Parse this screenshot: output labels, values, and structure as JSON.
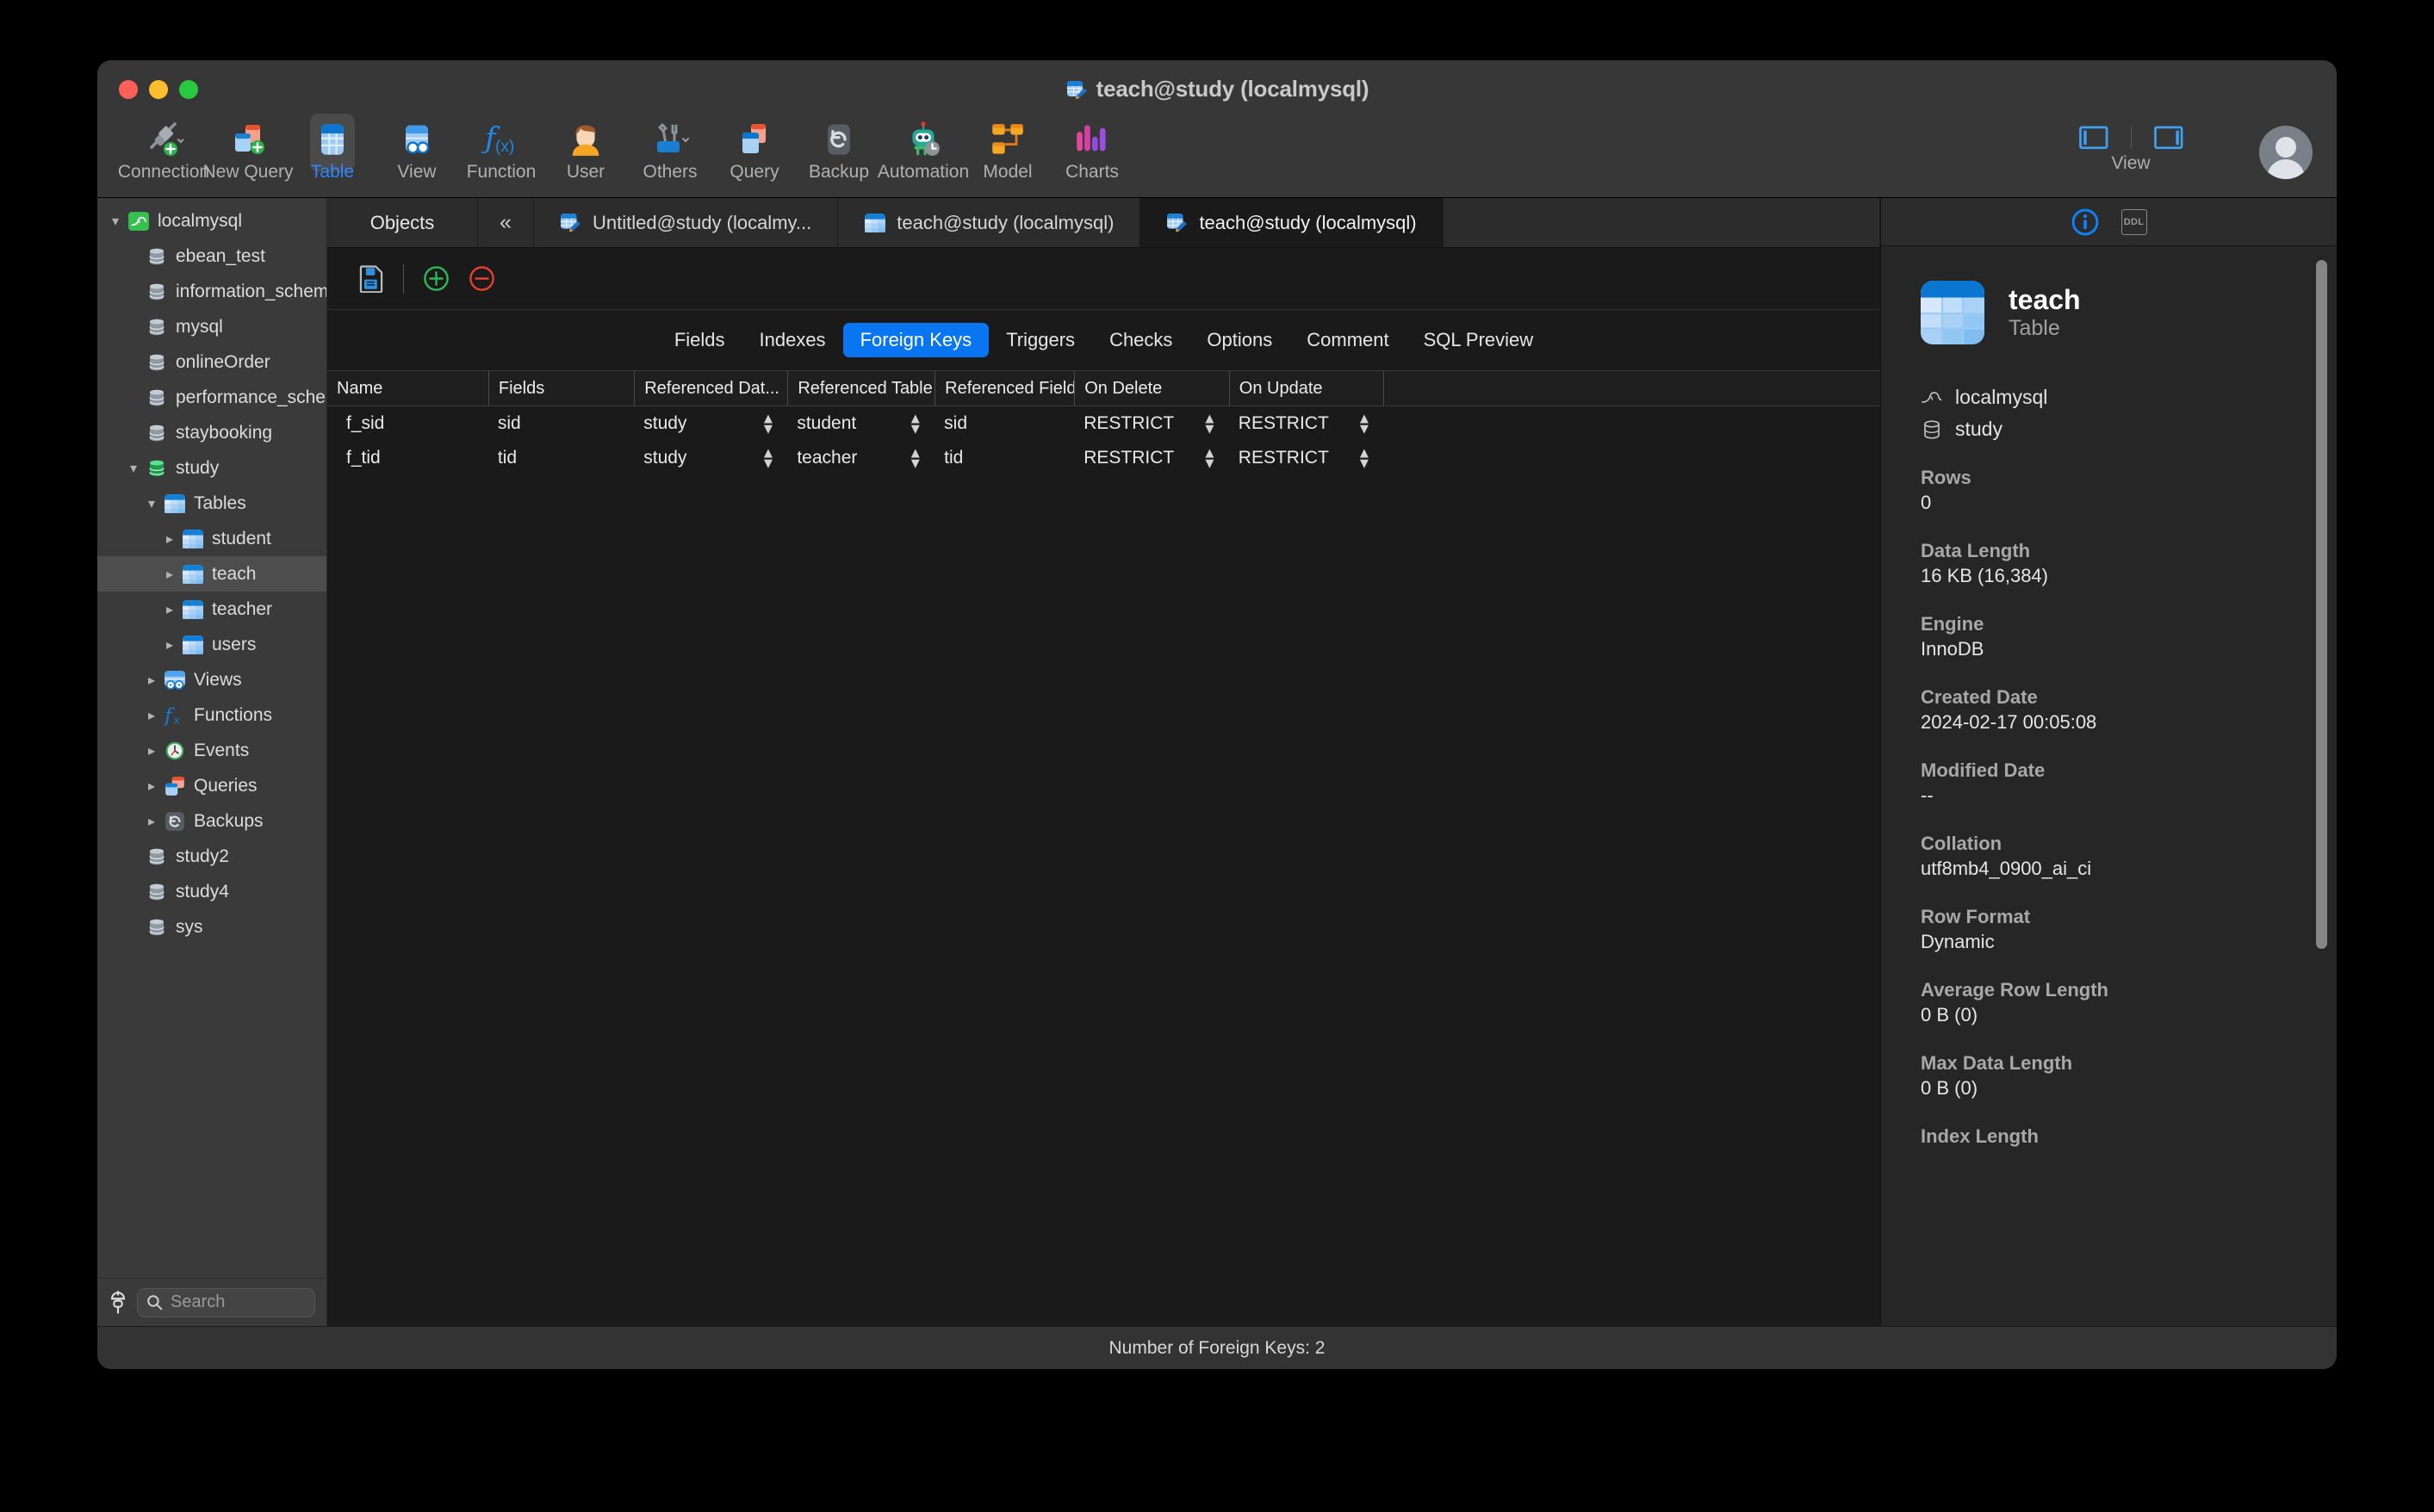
{
  "window": {
    "title": "teach@study (localmysql)",
    "traffic_lights": [
      "close",
      "minimize",
      "maximize"
    ]
  },
  "toolbar": {
    "items": [
      {
        "label": "Connection",
        "icon": "connection-icon",
        "selected": false
      },
      {
        "label": "New Query",
        "icon": "new-query-icon",
        "selected": false
      },
      {
        "label": "Table",
        "icon": "table-icon",
        "selected": true
      },
      {
        "label": "View",
        "icon": "view-icon",
        "selected": false
      },
      {
        "label": "Function",
        "icon": "function-icon",
        "selected": false
      },
      {
        "label": "User",
        "icon": "user-icon",
        "selected": false
      },
      {
        "label": "Others",
        "icon": "others-icon",
        "selected": false
      },
      {
        "label": "Query",
        "icon": "query-icon",
        "selected": false
      },
      {
        "label": "Backup",
        "icon": "backup-icon",
        "selected": false
      },
      {
        "label": "Automation",
        "icon": "automation-icon",
        "selected": false
      },
      {
        "label": "Model",
        "icon": "model-icon",
        "selected": false
      },
      {
        "label": "Charts",
        "icon": "charts-icon",
        "selected": false
      }
    ],
    "view_label": "View"
  },
  "sidebar": {
    "tree": [
      {
        "label": "localmysql",
        "indent": 0,
        "twisty": "down",
        "icon": "mysql-dolphin-icon",
        "selected": false
      },
      {
        "label": "ebean_test",
        "indent": 1,
        "twisty": "none",
        "icon": "database-icon",
        "selected": false
      },
      {
        "label": "information_schema",
        "indent": 1,
        "twisty": "none",
        "icon": "database-icon",
        "selected": false
      },
      {
        "label": "mysql",
        "indent": 1,
        "twisty": "none",
        "icon": "database-icon",
        "selected": false
      },
      {
        "label": "onlineOrder",
        "indent": 1,
        "twisty": "none",
        "icon": "database-icon",
        "selected": false
      },
      {
        "label": "performance_schema",
        "indent": 1,
        "twisty": "none",
        "icon": "database-icon",
        "selected": false
      },
      {
        "label": "staybooking",
        "indent": 1,
        "twisty": "none",
        "icon": "database-icon",
        "selected": false
      },
      {
        "label": "study",
        "indent": 1,
        "twisty": "down",
        "icon": "database-open-icon",
        "selected": false
      },
      {
        "label": "Tables",
        "indent": 2,
        "twisty": "down",
        "icon": "tables-folder-icon",
        "selected": false
      },
      {
        "label": "student",
        "indent": 3,
        "twisty": "right",
        "icon": "table-icon",
        "selected": false
      },
      {
        "label": "teach",
        "indent": 3,
        "twisty": "right",
        "icon": "table-icon",
        "selected": true
      },
      {
        "label": "teacher",
        "indent": 3,
        "twisty": "right",
        "icon": "table-icon",
        "selected": false
      },
      {
        "label": "users",
        "indent": 3,
        "twisty": "right",
        "icon": "table-icon",
        "selected": false
      },
      {
        "label": "Views",
        "indent": 2,
        "twisty": "right",
        "icon": "views-icon",
        "selected": false
      },
      {
        "label": "Functions",
        "indent": 2,
        "twisty": "right",
        "icon": "functions-icon",
        "selected": false
      },
      {
        "label": "Events",
        "indent": 2,
        "twisty": "right",
        "icon": "events-clock-icon",
        "selected": false
      },
      {
        "label": "Queries",
        "indent": 2,
        "twisty": "right",
        "icon": "queries-icon",
        "selected": false
      },
      {
        "label": "Backups",
        "indent": 2,
        "twisty": "right",
        "icon": "backup-icon",
        "selected": false
      },
      {
        "label": "study2",
        "indent": 1,
        "twisty": "none",
        "icon": "database-icon",
        "selected": false
      },
      {
        "label": "study4",
        "indent": 1,
        "twisty": "none",
        "icon": "database-icon",
        "selected": false
      },
      {
        "label": "sys",
        "indent": 1,
        "twisty": "none",
        "icon": "database-icon",
        "selected": false
      }
    ],
    "search_placeholder": "Search",
    "search_value": ""
  },
  "tabbar": {
    "objects_label": "Objects",
    "collapse_icon": "chevron-double-left-icon",
    "tabs": [
      {
        "label": "Untitled@study (localmy...",
        "icon": "query-editor-icon",
        "active": false
      },
      {
        "label": "teach@study (localmysql)",
        "icon": "table-icon",
        "active": false
      },
      {
        "label": "teach@study (localmysql)",
        "icon": "table-design-icon",
        "active": true
      }
    ]
  },
  "editor_toolbar": {
    "save_icon": "save-icon",
    "add_icon": "add-circle-icon",
    "remove_icon": "remove-circle-icon"
  },
  "subtabs": {
    "items": [
      {
        "label": "Fields",
        "active": false
      },
      {
        "label": "Indexes",
        "active": false
      },
      {
        "label": "Foreign Keys",
        "active": true
      },
      {
        "label": "Triggers",
        "active": false
      },
      {
        "label": "Checks",
        "active": false
      },
      {
        "label": "Options",
        "active": false
      },
      {
        "label": "Comment",
        "active": false
      },
      {
        "label": "SQL Preview",
        "active": false
      }
    ],
    "accent": "#0a75f0"
  },
  "grid": {
    "columns": [
      {
        "label": "Name",
        "width": 128
      },
      {
        "label": "Fields",
        "width": 116
      },
      {
        "label": "Referenced Dat...",
        "width": 122
      },
      {
        "label": "Referenced Table",
        "width": 117
      },
      {
        "label": "Referenced Fields",
        "width": 111
      },
      {
        "label": "On Delete",
        "width": 123
      },
      {
        "label": "On Update",
        "width": 123
      }
    ],
    "rows": [
      {
        "name": "f_sid",
        "fields": "sid",
        "referenced_database": "study",
        "referenced_table": "student",
        "referenced_fields": "sid",
        "on_delete": "RESTRICT",
        "on_update": "RESTRICT"
      },
      {
        "name": "f_tid",
        "fields": "tid",
        "referenced_database": "study",
        "referenced_table": "teacher",
        "referenced_fields": "tid",
        "on_delete": "RESTRICT",
        "on_update": "RESTRICT"
      }
    ]
  },
  "info_panel": {
    "tabs": [
      {
        "label": "info",
        "icon": "info-circle-icon",
        "active": true
      },
      {
        "label": "DDL",
        "icon": "ddl-icon",
        "active": false
      }
    ],
    "ddl_label": "DDL",
    "object_name": "teach",
    "object_type": "Table",
    "connection": "localmysql",
    "database": "study",
    "properties": [
      {
        "label": "Rows",
        "value": "0"
      },
      {
        "label": "Data Length",
        "value": "16 KB (16,384)"
      },
      {
        "label": "Engine",
        "value": "InnoDB"
      },
      {
        "label": "Created Date",
        "value": "2024-02-17 00:05:08"
      },
      {
        "label": "Modified Date",
        "value": "--"
      },
      {
        "label": "Collation",
        "value": "utf8mb4_0900_ai_ci"
      },
      {
        "label": "Row Format",
        "value": "Dynamic"
      },
      {
        "label": "Average Row Length",
        "value": "0 B (0)"
      },
      {
        "label": "Max Data Length",
        "value": "0 B (0)"
      },
      {
        "label": "Index Length",
        "value": ""
      }
    ]
  },
  "status_bar": {
    "text": "Number of Foreign Keys: 2"
  }
}
